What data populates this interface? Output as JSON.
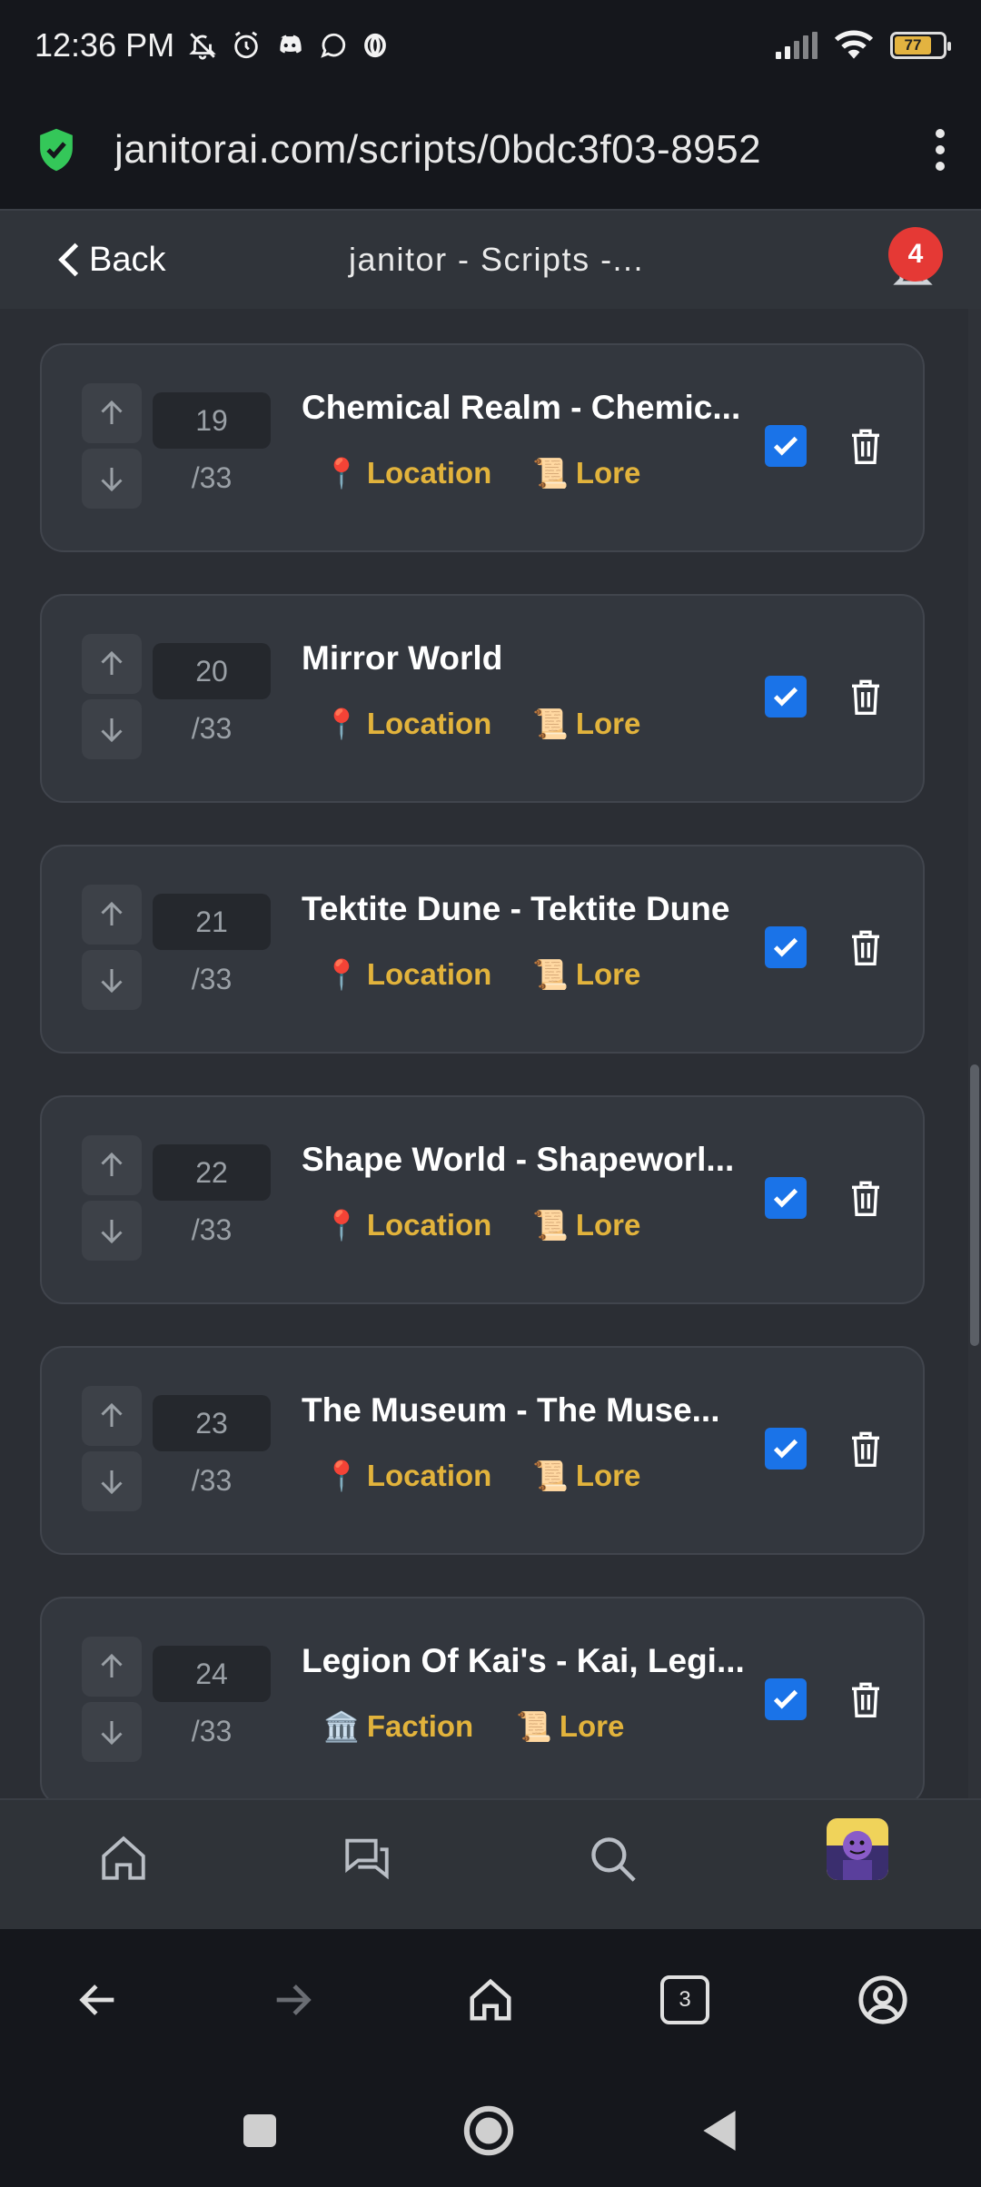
{
  "status_bar": {
    "time": "12:36 PM",
    "battery": "77"
  },
  "url_bar": {
    "url": "janitorai.com/scripts/0bdc3f03-8952"
  },
  "header": {
    "back_label": "Back",
    "title": "janitor - Scripts -...",
    "notification_count": "4"
  },
  "entries": [
    {
      "order": "19",
      "total": "/33",
      "title": "Chemical Realm - Chemic...",
      "tag1_icon": "📍",
      "tag1": "Location",
      "tag2_icon": "📜",
      "tag2": "Lore",
      "enabled": true
    },
    {
      "order": "20",
      "total": "/33",
      "title": "Mirror World",
      "tag1_icon": "📍",
      "tag1": "Location",
      "tag2_icon": "📜",
      "tag2": "Lore",
      "enabled": true
    },
    {
      "order": "21",
      "total": "/33",
      "title": "Tektite Dune - Tektite Dune",
      "tag1_icon": "📍",
      "tag1": "Location",
      "tag2_icon": "📜",
      "tag2": "Lore",
      "enabled": true
    },
    {
      "order": "22",
      "total": "/33",
      "title": "Shape World - Shapeworl...",
      "tag1_icon": "📍",
      "tag1": "Location",
      "tag2_icon": "📜",
      "tag2": "Lore",
      "enabled": true
    },
    {
      "order": "23",
      "total": "/33",
      "title": "The Museum - The Muse...",
      "tag1_icon": "📍",
      "tag1": "Location",
      "tag2_icon": "📜",
      "tag2": "Lore",
      "enabled": true
    },
    {
      "order": "24",
      "total": "/33",
      "title": "Legion Of Kai's - Kai, Legi...",
      "tag1_icon": "🏛️",
      "tag1": "Faction",
      "tag2_icon": "📜",
      "tag2": "Lore",
      "enabled": true
    }
  ],
  "browser_bar": {
    "tab_count": "3"
  },
  "colors": {
    "accent": "#1a73e8",
    "tag": "#e2b33c",
    "badge": "#e53935"
  }
}
